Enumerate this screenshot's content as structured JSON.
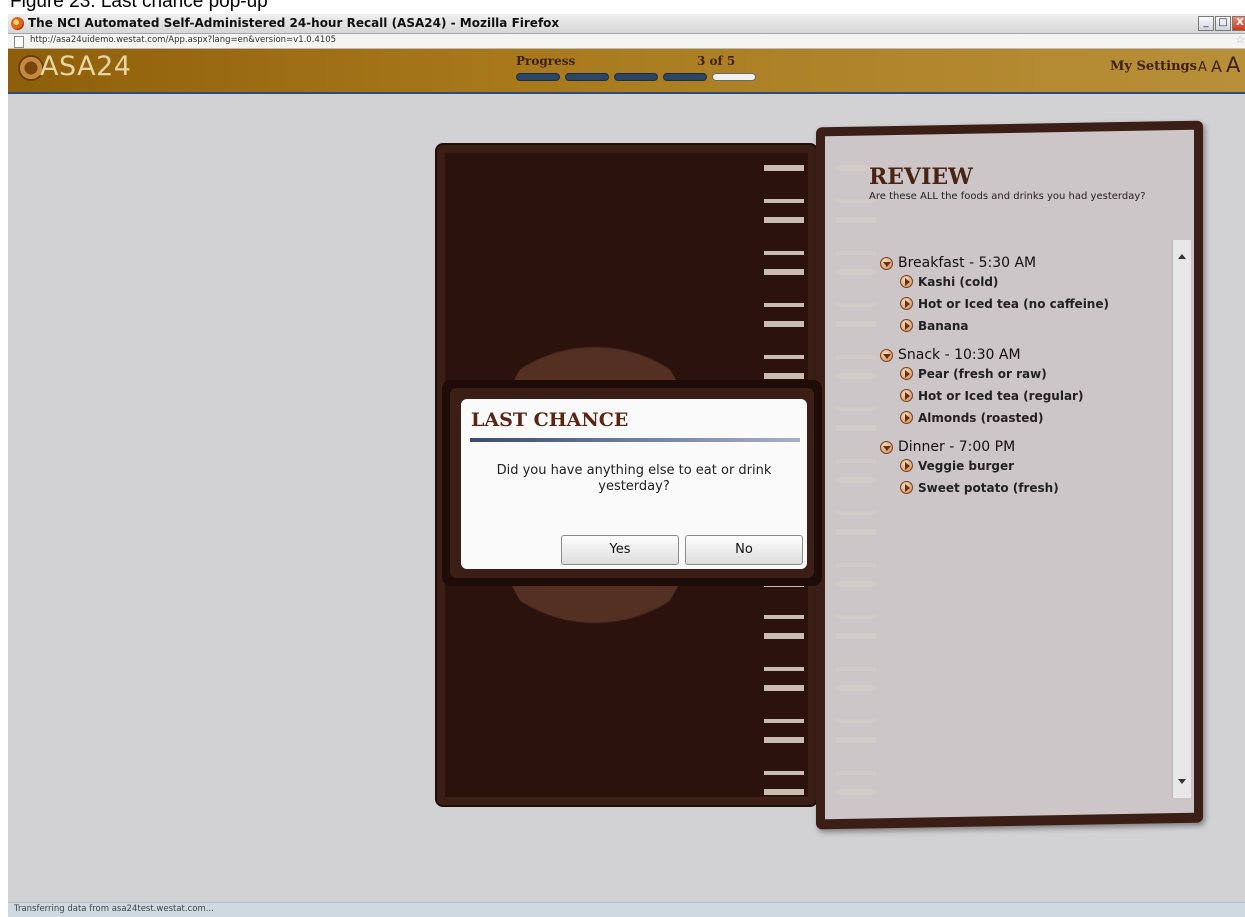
{
  "figure_caption": "Figure 23. Last chance pop-up",
  "browser": {
    "window_title": "The NCI Automated Self-Administered 24-hour Recall (ASA24) - Mozilla Firefox",
    "url": "http://asa24uidemo.westat.com/App.aspx?lang=en&version=v1.0.4105",
    "status": "Transferring data from asa24test.westat.com...",
    "minimize_label": "_",
    "maximize_label": "□",
    "close_label": "X"
  },
  "header": {
    "logo_text": "ASA24",
    "progress_label": "Progress",
    "progress_count": "3 of 5",
    "progress_fraction": 0.6,
    "settings_label": "My Settings",
    "font_small": "A",
    "font_medium": "A",
    "font_large": "A"
  },
  "review": {
    "title": "REVIEW",
    "subtitle": "Are these ALL the foods and drinks you had yesterday?",
    "meals": [
      {
        "title": "Breakfast - 5:30 AM",
        "foods": [
          "Kashi (cold)",
          "Hot or Iced tea (no caffeine)",
          "Banana"
        ]
      },
      {
        "title": "Snack - 10:30 AM",
        "foods": [
          "Pear (fresh or raw)",
          "Hot or Iced tea (regular)",
          "Almonds (roasted)"
        ]
      },
      {
        "title": "Dinner - 7:00 PM",
        "foods": [
          "Veggie burger",
          "Sweet potato (fresh)"
        ]
      }
    ]
  },
  "dialog": {
    "title": "LAST CHANCE",
    "message": "Did you have anything else to eat or drink yesterday?",
    "yes_label": "Yes",
    "no_label": "No"
  },
  "colors": {
    "header_brown": "#a8791b",
    "panel_brown": "#3b1e16",
    "progress_navy": "#2d4566",
    "title_brown": "#5a2613"
  },
  "icons": [
    "firefox-icon",
    "page-icon",
    "bookmark-star-icon",
    "asa24-logo-icon",
    "expand-down-icon",
    "expand-right-icon",
    "scroll-up-icon",
    "scroll-down-icon"
  ]
}
